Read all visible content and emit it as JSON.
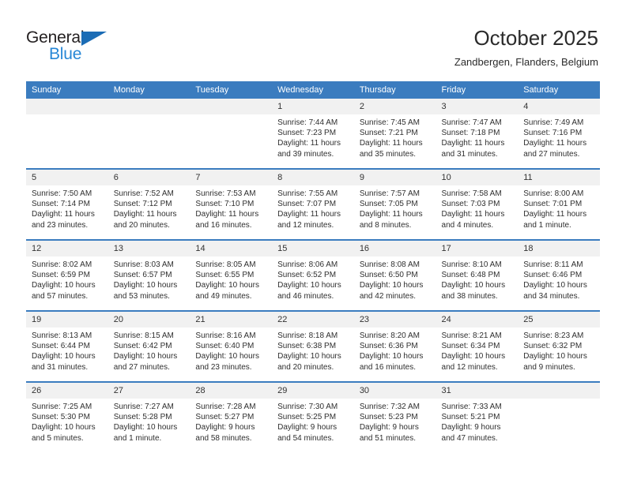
{
  "brand": {
    "name_part1": "General",
    "name_part2": "Blue"
  },
  "header": {
    "month_title": "October 2025",
    "location": "Zandbergen, Flanders, Belgium"
  },
  "colors": {
    "header_blue": "#3b7cbf",
    "logo_blue": "#2787d6",
    "daynum_bg": "#f1f1f1"
  },
  "weekdays": [
    "Sunday",
    "Monday",
    "Tuesday",
    "Wednesday",
    "Thursday",
    "Friday",
    "Saturday"
  ],
  "weeks": [
    [
      {
        "day": "",
        "sunrise": "",
        "sunset": "",
        "daylight": "",
        "empty": true
      },
      {
        "day": "",
        "sunrise": "",
        "sunset": "",
        "daylight": "",
        "empty": true
      },
      {
        "day": "",
        "sunrise": "",
        "sunset": "",
        "daylight": "",
        "empty": true
      },
      {
        "day": "1",
        "sunrise": "Sunrise: 7:44 AM",
        "sunset": "Sunset: 7:23 PM",
        "daylight": "Daylight: 11 hours and 39 minutes."
      },
      {
        "day": "2",
        "sunrise": "Sunrise: 7:45 AM",
        "sunset": "Sunset: 7:21 PM",
        "daylight": "Daylight: 11 hours and 35 minutes."
      },
      {
        "day": "3",
        "sunrise": "Sunrise: 7:47 AM",
        "sunset": "Sunset: 7:18 PM",
        "daylight": "Daylight: 11 hours and 31 minutes."
      },
      {
        "day": "4",
        "sunrise": "Sunrise: 7:49 AM",
        "sunset": "Sunset: 7:16 PM",
        "daylight": "Daylight: 11 hours and 27 minutes."
      }
    ],
    [
      {
        "day": "5",
        "sunrise": "Sunrise: 7:50 AM",
        "sunset": "Sunset: 7:14 PM",
        "daylight": "Daylight: 11 hours and 23 minutes."
      },
      {
        "day": "6",
        "sunrise": "Sunrise: 7:52 AM",
        "sunset": "Sunset: 7:12 PM",
        "daylight": "Daylight: 11 hours and 20 minutes."
      },
      {
        "day": "7",
        "sunrise": "Sunrise: 7:53 AM",
        "sunset": "Sunset: 7:10 PM",
        "daylight": "Daylight: 11 hours and 16 minutes."
      },
      {
        "day": "8",
        "sunrise": "Sunrise: 7:55 AM",
        "sunset": "Sunset: 7:07 PM",
        "daylight": "Daylight: 11 hours and 12 minutes."
      },
      {
        "day": "9",
        "sunrise": "Sunrise: 7:57 AM",
        "sunset": "Sunset: 7:05 PM",
        "daylight": "Daylight: 11 hours and 8 minutes."
      },
      {
        "day": "10",
        "sunrise": "Sunrise: 7:58 AM",
        "sunset": "Sunset: 7:03 PM",
        "daylight": "Daylight: 11 hours and 4 minutes."
      },
      {
        "day": "11",
        "sunrise": "Sunrise: 8:00 AM",
        "sunset": "Sunset: 7:01 PM",
        "daylight": "Daylight: 11 hours and 1 minute."
      }
    ],
    [
      {
        "day": "12",
        "sunrise": "Sunrise: 8:02 AM",
        "sunset": "Sunset: 6:59 PM",
        "daylight": "Daylight: 10 hours and 57 minutes."
      },
      {
        "day": "13",
        "sunrise": "Sunrise: 8:03 AM",
        "sunset": "Sunset: 6:57 PM",
        "daylight": "Daylight: 10 hours and 53 minutes."
      },
      {
        "day": "14",
        "sunrise": "Sunrise: 8:05 AM",
        "sunset": "Sunset: 6:55 PM",
        "daylight": "Daylight: 10 hours and 49 minutes."
      },
      {
        "day": "15",
        "sunrise": "Sunrise: 8:06 AM",
        "sunset": "Sunset: 6:52 PM",
        "daylight": "Daylight: 10 hours and 46 minutes."
      },
      {
        "day": "16",
        "sunrise": "Sunrise: 8:08 AM",
        "sunset": "Sunset: 6:50 PM",
        "daylight": "Daylight: 10 hours and 42 minutes."
      },
      {
        "day": "17",
        "sunrise": "Sunrise: 8:10 AM",
        "sunset": "Sunset: 6:48 PM",
        "daylight": "Daylight: 10 hours and 38 minutes."
      },
      {
        "day": "18",
        "sunrise": "Sunrise: 8:11 AM",
        "sunset": "Sunset: 6:46 PM",
        "daylight": "Daylight: 10 hours and 34 minutes."
      }
    ],
    [
      {
        "day": "19",
        "sunrise": "Sunrise: 8:13 AM",
        "sunset": "Sunset: 6:44 PM",
        "daylight": "Daylight: 10 hours and 31 minutes."
      },
      {
        "day": "20",
        "sunrise": "Sunrise: 8:15 AM",
        "sunset": "Sunset: 6:42 PM",
        "daylight": "Daylight: 10 hours and 27 minutes."
      },
      {
        "day": "21",
        "sunrise": "Sunrise: 8:16 AM",
        "sunset": "Sunset: 6:40 PM",
        "daylight": "Daylight: 10 hours and 23 minutes."
      },
      {
        "day": "22",
        "sunrise": "Sunrise: 8:18 AM",
        "sunset": "Sunset: 6:38 PM",
        "daylight": "Daylight: 10 hours and 20 minutes."
      },
      {
        "day": "23",
        "sunrise": "Sunrise: 8:20 AM",
        "sunset": "Sunset: 6:36 PM",
        "daylight": "Daylight: 10 hours and 16 minutes."
      },
      {
        "day": "24",
        "sunrise": "Sunrise: 8:21 AM",
        "sunset": "Sunset: 6:34 PM",
        "daylight": "Daylight: 10 hours and 12 minutes."
      },
      {
        "day": "25",
        "sunrise": "Sunrise: 8:23 AM",
        "sunset": "Sunset: 6:32 PM",
        "daylight": "Daylight: 10 hours and 9 minutes."
      }
    ],
    [
      {
        "day": "26",
        "sunrise": "Sunrise: 7:25 AM",
        "sunset": "Sunset: 5:30 PM",
        "daylight": "Daylight: 10 hours and 5 minutes."
      },
      {
        "day": "27",
        "sunrise": "Sunrise: 7:27 AM",
        "sunset": "Sunset: 5:28 PM",
        "daylight": "Daylight: 10 hours and 1 minute."
      },
      {
        "day": "28",
        "sunrise": "Sunrise: 7:28 AM",
        "sunset": "Sunset: 5:27 PM",
        "daylight": "Daylight: 9 hours and 58 minutes."
      },
      {
        "day": "29",
        "sunrise": "Sunrise: 7:30 AM",
        "sunset": "Sunset: 5:25 PM",
        "daylight": "Daylight: 9 hours and 54 minutes."
      },
      {
        "day": "30",
        "sunrise": "Sunrise: 7:32 AM",
        "sunset": "Sunset: 5:23 PM",
        "daylight": "Daylight: 9 hours and 51 minutes."
      },
      {
        "day": "31",
        "sunrise": "Sunrise: 7:33 AM",
        "sunset": "Sunset: 5:21 PM",
        "daylight": "Daylight: 9 hours and 47 minutes."
      },
      {
        "day": "",
        "sunrise": "",
        "sunset": "",
        "daylight": "",
        "empty": true
      }
    ]
  ]
}
